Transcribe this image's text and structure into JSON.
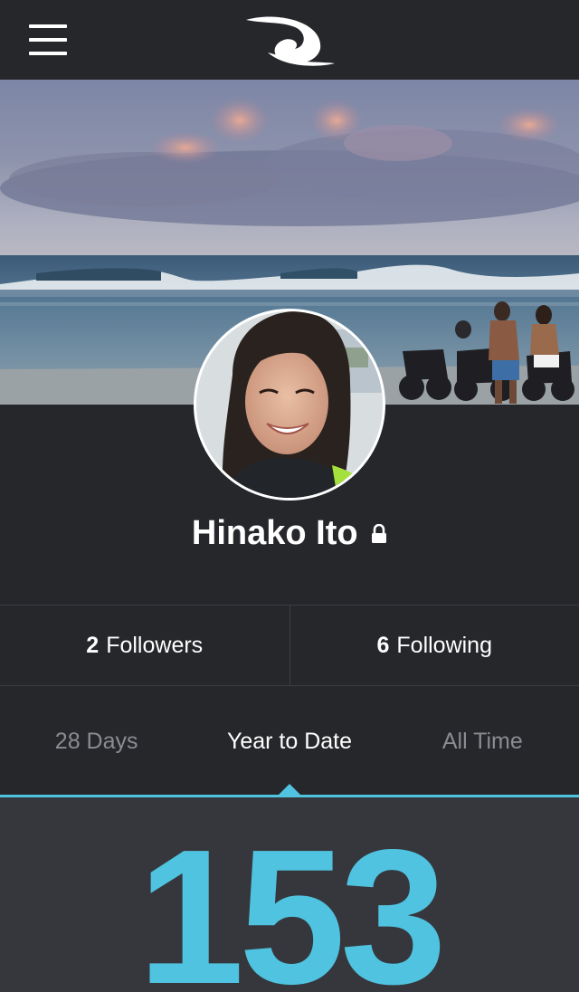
{
  "profile": {
    "name": "Hinako Ito",
    "private": true
  },
  "social": {
    "followers_count": "2",
    "followers_label": "Followers",
    "following_count": "6",
    "following_label": "Following"
  },
  "tabs": [
    {
      "label": "28 Days",
      "active": false
    },
    {
      "label": "Year to Date",
      "active": true
    },
    {
      "label": "All Time",
      "active": false
    }
  ],
  "stat": {
    "value": "153"
  },
  "colors": {
    "background": "#26272b",
    "accent": "#4fc3e0",
    "panel": "#36373c"
  },
  "icons": {
    "menu": "hamburger-menu-icon",
    "logo": "wave-logo",
    "lock": "lock-icon"
  }
}
